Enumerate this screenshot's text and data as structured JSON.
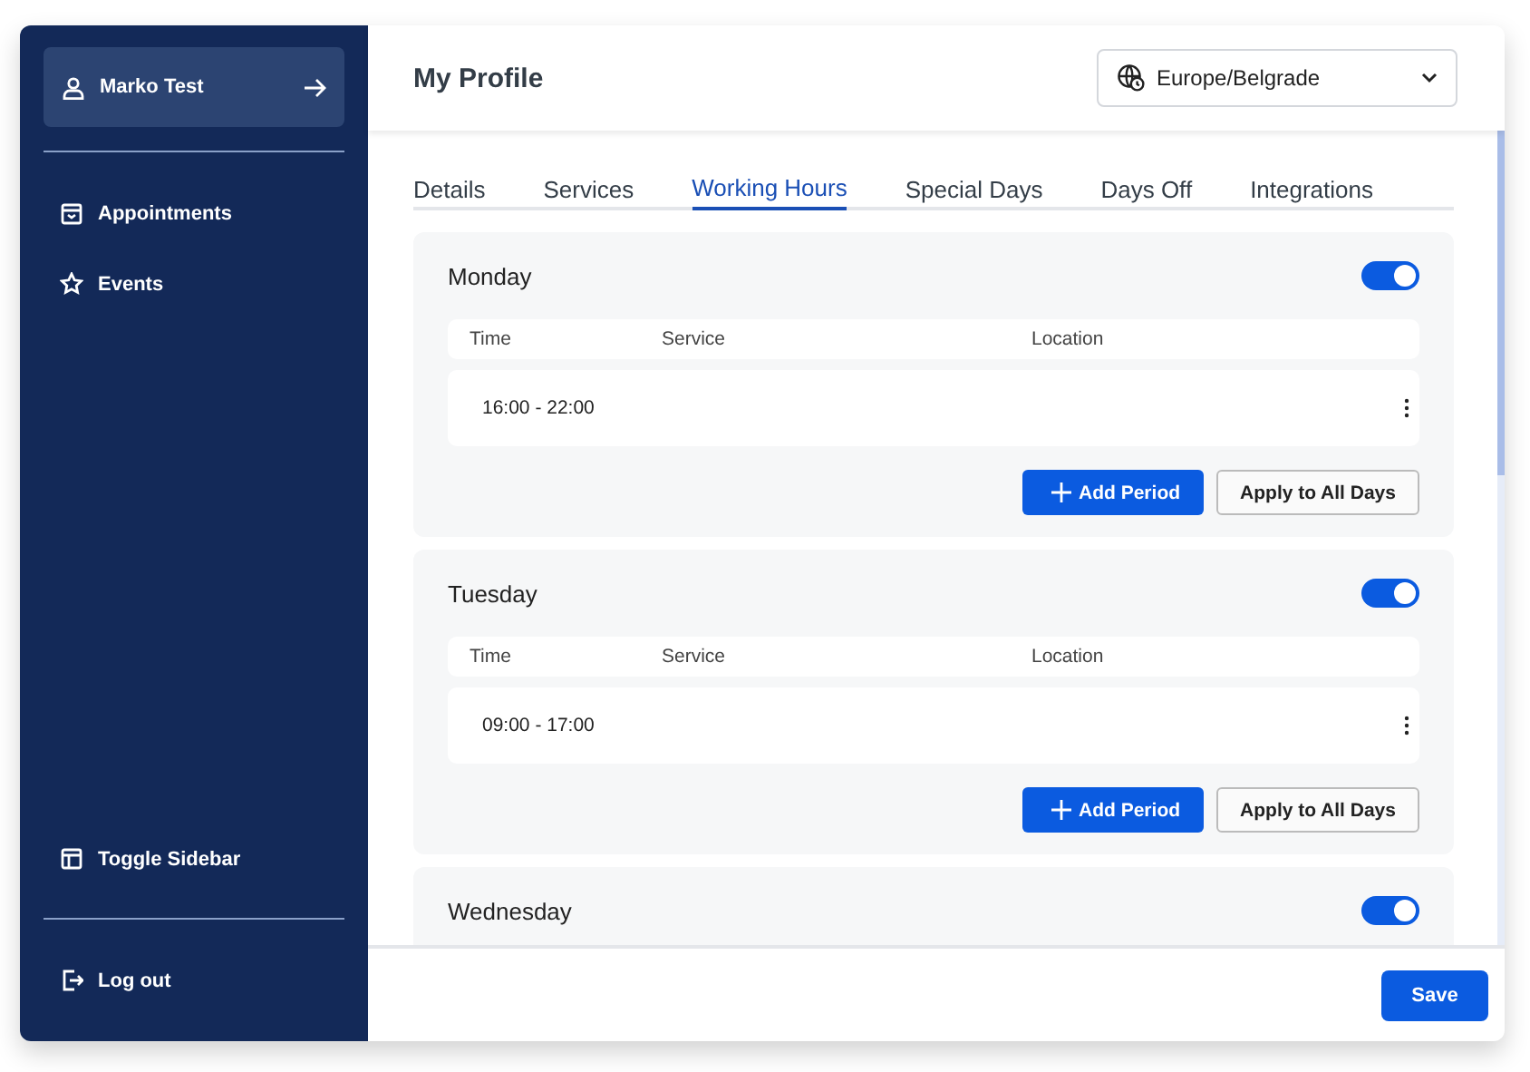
{
  "sidebar": {
    "user": {
      "name": "Marko Test"
    },
    "items": [
      {
        "label": "Appointments"
      },
      {
        "label": "Events"
      }
    ],
    "bottom_items": [
      {
        "label": "Toggle Sidebar"
      },
      {
        "label": "Log out"
      }
    ]
  },
  "header": {
    "title": "My Profile",
    "timezone": "Europe/Belgrade"
  },
  "tabs": [
    {
      "label": "Details",
      "selected": false
    },
    {
      "label": "Services",
      "selected": false
    },
    {
      "label": "Working Hours",
      "selected": true
    },
    {
      "label": "Special Days",
      "selected": false
    },
    {
      "label": "Days Off",
      "selected": false
    },
    {
      "label": "Integrations",
      "selected": false
    }
  ],
  "days": [
    {
      "name": "Monday",
      "on": true,
      "columns": [
        "Time",
        "Service",
        "Location"
      ],
      "periods": [
        {
          "time": "16:00 - 22:00"
        }
      ],
      "buttons": [
        "Add Period",
        "Apply to All Days"
      ]
    },
    {
      "name": "Tuesday",
      "on": true,
      "columns": [
        "Time",
        "Service",
        "Location"
      ],
      "periods": [
        {
          "time": "09:00 - 17:00"
        }
      ],
      "buttons": [
        "Add Period",
        "Apply to All Days"
      ]
    },
    {
      "name": "Wednesday",
      "on": true
    }
  ],
  "footer": {
    "button": "Save"
  }
}
